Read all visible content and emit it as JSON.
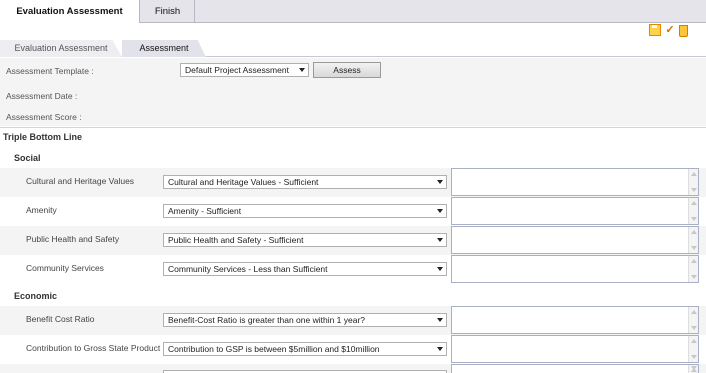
{
  "top_tabs": {
    "active": "Evaluation Assessment",
    "finish": "Finish"
  },
  "toolbar": {
    "icons": [
      "save-icon",
      "spellcheck-icon",
      "delete-icon"
    ]
  },
  "sub_tabs": [
    "Evaluation Assessment",
    "Assessment"
  ],
  "assessment": {
    "template_label": "Assessment Template :",
    "template_value": "Default Project Assessment",
    "assess_button": "Assess",
    "date_label": "Assessment Date :",
    "score_label": "Assessment Score :"
  },
  "tbl": {
    "title": "Triple Bottom Line",
    "groups": [
      {
        "name": "Social",
        "rows": [
          {
            "label": "Cultural and Heritage Values",
            "value": "Cultural and Heritage Values - Sufficient"
          },
          {
            "label": "Amenity",
            "value": "Amenity - Sufficient"
          },
          {
            "label": "Public Health and Safety",
            "value": "Public Health and Safety - Sufficient"
          },
          {
            "label": "Community Services",
            "value": "Community Services - Less than Sufficient"
          }
        ]
      },
      {
        "name": "Economic",
        "rows": [
          {
            "label": "Benefit Cost Ratio",
            "value": "Benefit-Cost Ratio is greater than one within 1 year?"
          },
          {
            "label": "Contribution to Gross State Product",
            "value": "Contribution to GSP is between $5million and $10million"
          }
        ]
      }
    ]
  }
}
